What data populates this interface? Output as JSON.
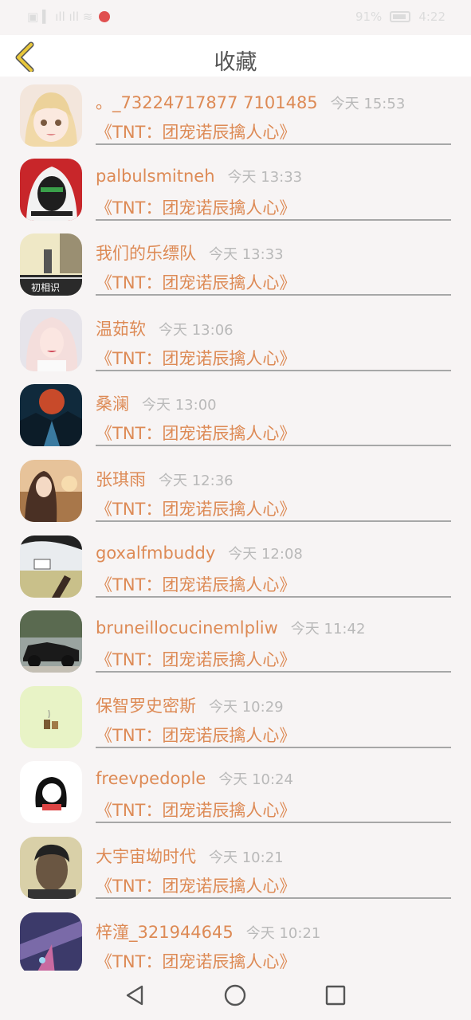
{
  "status_bar": {
    "left_glyphs": "▣ ▍ ıll ıll ≋",
    "right_text": "91%",
    "time": "4:22"
  },
  "header": {
    "title": "收藏",
    "back_icon": "chevron-left-icon",
    "back_color": "#e8c73a"
  },
  "items": [
    {
      "name": "。_73224717877 7101485",
      "time": "今天 15:53",
      "book": "《TNT：团宠诺辰擒人心》"
    },
    {
      "name": "palbulsmitneh",
      "time": "今天 13:33",
      "book": "《TNT：团宠诺辰擒人心》"
    },
    {
      "name": "我们的乐缥队",
      "time": "今天 13:33",
      "book": "《TNT：团宠诺辰擒人心》"
    },
    {
      "name": "温茹软",
      "time": "今天 13:06",
      "book": "《TNT：团宠诺辰擒人心》"
    },
    {
      "name": "桑澜",
      "time": "今天 13:00",
      "book": "《TNT：团宠诺辰擒人心》"
    },
    {
      "name": "张琪雨",
      "time": "今天 12:36",
      "book": "《TNT：团宠诺辰擒人心》"
    },
    {
      "name": "goxalfmbuddy",
      "time": "今天 12:08",
      "book": "《TNT：团宠诺辰擒人心》"
    },
    {
      "name": "bruneillocucinemlpliw",
      "time": "今天 11:42",
      "book": "《TNT：团宠诺辰擒人心》"
    },
    {
      "name": "保智罗史密斯",
      "time": "今天 10:29",
      "book": "《TNT：团宠诺辰擒人心》"
    },
    {
      "name": "freevpedople",
      "time": "今天 10:24",
      "book": "《TNT：团宠诺辰擒人心》"
    },
    {
      "name": "大宇宙坳时代",
      "time": "今天 10:21",
      "book": "《TNT：团宠诺辰擒人心》"
    },
    {
      "name": "梓潼_321944645",
      "time": "今天 10:21",
      "book": "《TNT：团宠诺辰擒人心》"
    }
  ],
  "nav": {
    "back_icon": "triangle-back-icon",
    "home_icon": "circle-home-icon",
    "recent_icon": "square-recents-icon"
  }
}
